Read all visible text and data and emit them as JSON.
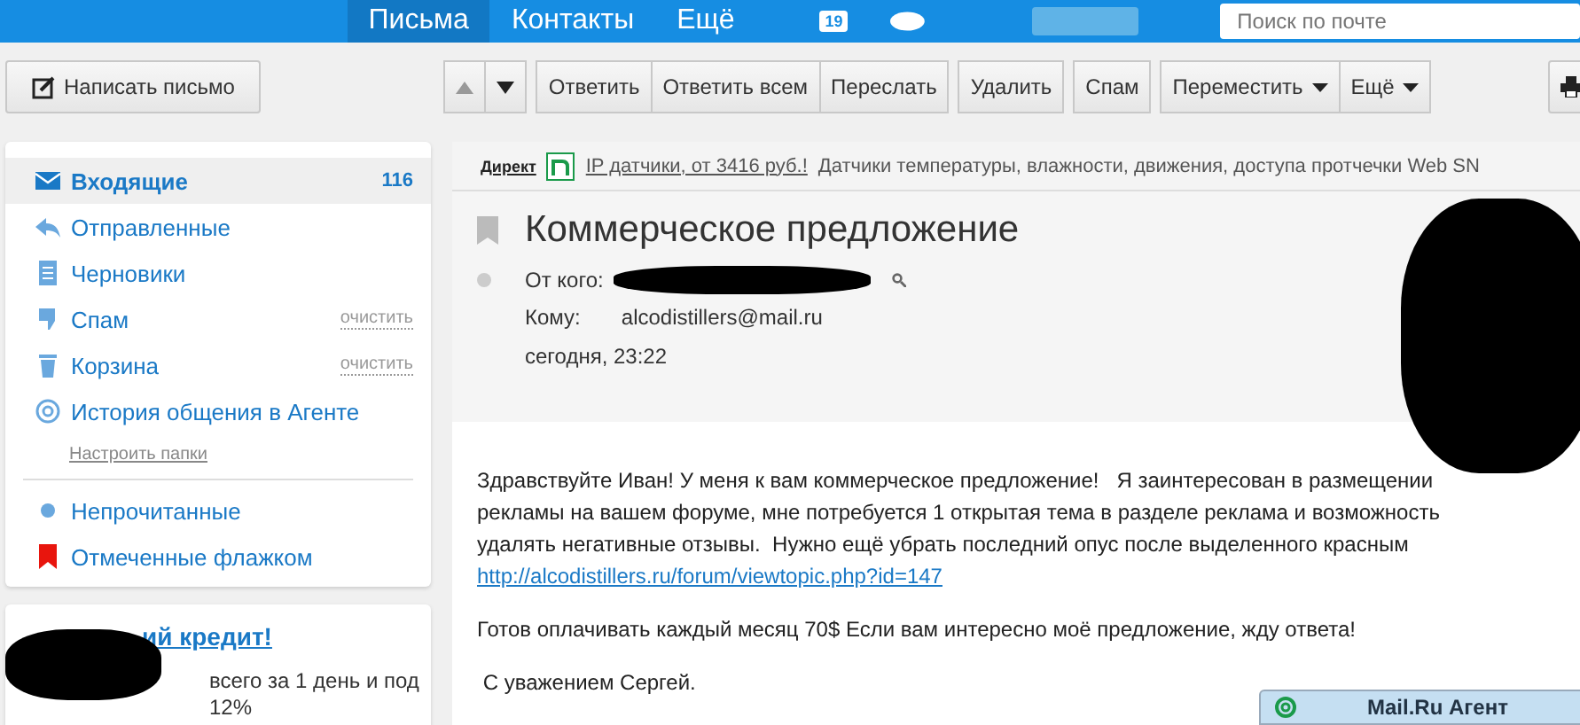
{
  "header": {
    "tabs": [
      {
        "label": "Письма",
        "selected": true
      },
      {
        "label": "Контакты",
        "selected": false
      },
      {
        "label": "Ещё",
        "selected": false
      }
    ],
    "calendar_badge": "19",
    "search": {
      "placeholder": "Поиск по почте"
    }
  },
  "toolbar": {
    "compose": "Написать письмо",
    "groups": [
      [
        {
          "kind": "arrow-up",
          "disabled": true
        },
        {
          "kind": "arrow-down",
          "disabled": false
        }
      ],
      [
        {
          "kind": "text",
          "label": "Ответить"
        },
        {
          "kind": "text",
          "label": "Ответить всем"
        },
        {
          "kind": "text",
          "label": "Переслать"
        }
      ],
      [
        {
          "kind": "text",
          "label": "Удалить"
        }
      ],
      [
        {
          "kind": "text",
          "label": "Спам"
        }
      ],
      [
        {
          "kind": "menu",
          "label": "Переместить"
        },
        {
          "kind": "menu",
          "label": "Ещё"
        }
      ]
    ]
  },
  "sidebar": {
    "folders": [
      {
        "label": "Входящие",
        "count": "116",
        "selected": true
      },
      {
        "label": "Отправленные",
        "selected": false
      },
      {
        "label": "Черновики",
        "selected": false
      },
      {
        "label": "Спам",
        "action": "очистить",
        "selected": false
      },
      {
        "label": "Корзина",
        "action": "очистить",
        "selected": false
      },
      {
        "label": "История общения в Агенте",
        "selected": false
      }
    ],
    "settings_link": "Настроить папки",
    "filters": [
      {
        "label": "Непрочитанные"
      },
      {
        "label": "Отмеченные флажком"
      }
    ],
    "ad": {
      "title": "ий кредит!",
      "text": "всего за 1 день и под 12%"
    }
  },
  "message": {
    "ad": {
      "label": "Директ",
      "link": "IP датчики, от 3416 руб.!",
      "text": "Датчики температуры, влажности, движения, доступа протчечки Web SN"
    },
    "flagged": false,
    "unread": false,
    "subject": "Коммерческое предложение",
    "from_label": "От кого:",
    "to_label": "Кому:",
    "to": "alcodistillers@mail.ru",
    "date": "сегодня, 23:22",
    "body": [
      {
        "text": "Здравствуйте Иван! У меня к вам коммерческое предложение!   Я заинтересован в размещении рекламы на вашем форуме, мне потребуется 1 открытая тема в разделе реклама и возможность удалять негативные отзывы.  Нужно ещё убрать последний опус после выделенного красным ",
        "link": "http://alcodistillers.ru/forum/viewtopic.php?id=147"
      },
      {
        "text": "Готов оплачивать каждый месяц 70$ Если вам интересно моё предложение, жду ответа!"
      },
      {
        "text": " С уважением Сергей."
      }
    ]
  },
  "agent": {
    "title": "Mail.Ru Агент"
  }
}
